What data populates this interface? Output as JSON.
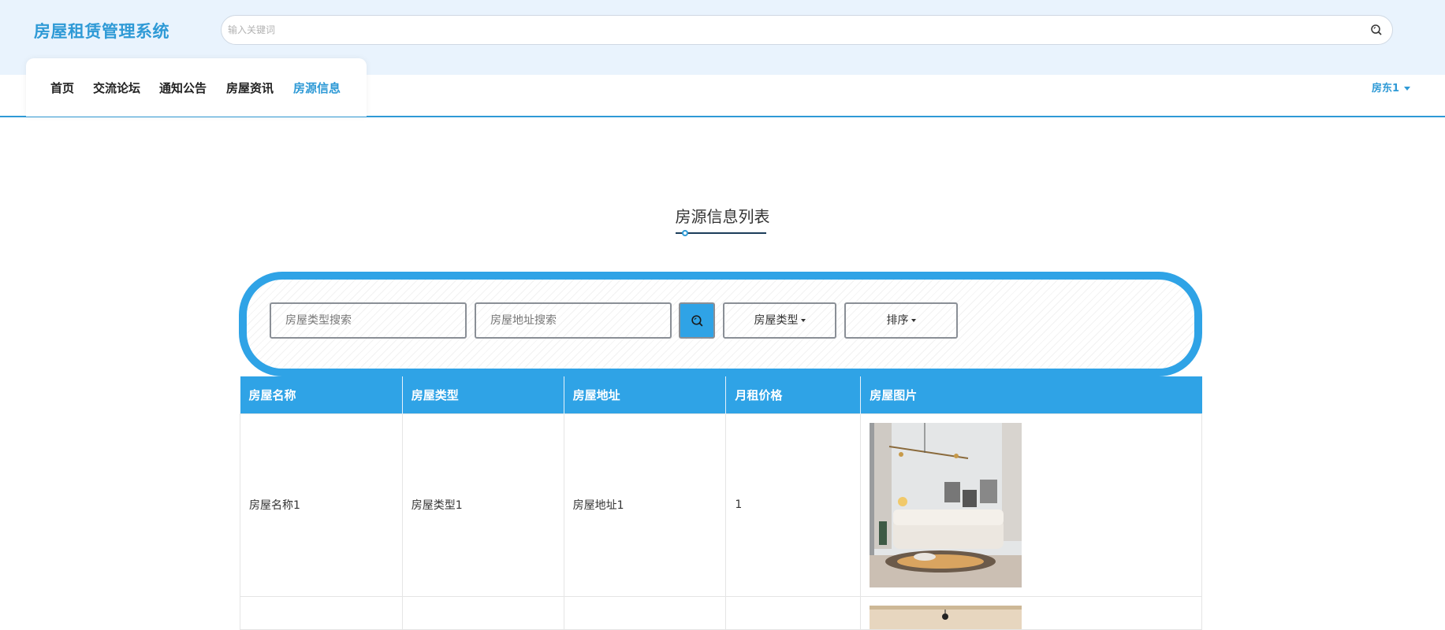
{
  "app": {
    "title": "房屋租赁管理系统"
  },
  "top_search": {
    "placeholder": "输入关键词"
  },
  "nav": {
    "items": [
      {
        "label": "首页"
      },
      {
        "label": "交流论坛"
      },
      {
        "label": "通知公告"
      },
      {
        "label": "房屋资讯"
      },
      {
        "label": "房源信息"
      }
    ],
    "active": "房源信息"
  },
  "user": {
    "name": "房东1"
  },
  "page": {
    "title": "房源信息列表"
  },
  "filter": {
    "type_placeholder": "房屋类型搜索",
    "address_placeholder": "房屋地址搜索",
    "type_dropdown": "房屋类型",
    "sort_dropdown": "排序"
  },
  "table": {
    "columns": [
      "房屋名称",
      "房屋类型",
      "房屋地址",
      "月租价格",
      "房屋图片"
    ],
    "rows": [
      {
        "name": "房屋名称1",
        "type": "房屋类型1",
        "address": "房屋地址1",
        "price": "1",
        "image": "living-room-photo"
      },
      {
        "name": "",
        "type": "",
        "address": "",
        "price": "",
        "image": "interior-photo"
      }
    ]
  },
  "colors": {
    "accent": "#2fa3e6",
    "header_bg": "#e9f3fd",
    "brand": "#2f9ad6"
  },
  "icons": {
    "search": "search-icon",
    "caret": "caret-down-icon"
  }
}
